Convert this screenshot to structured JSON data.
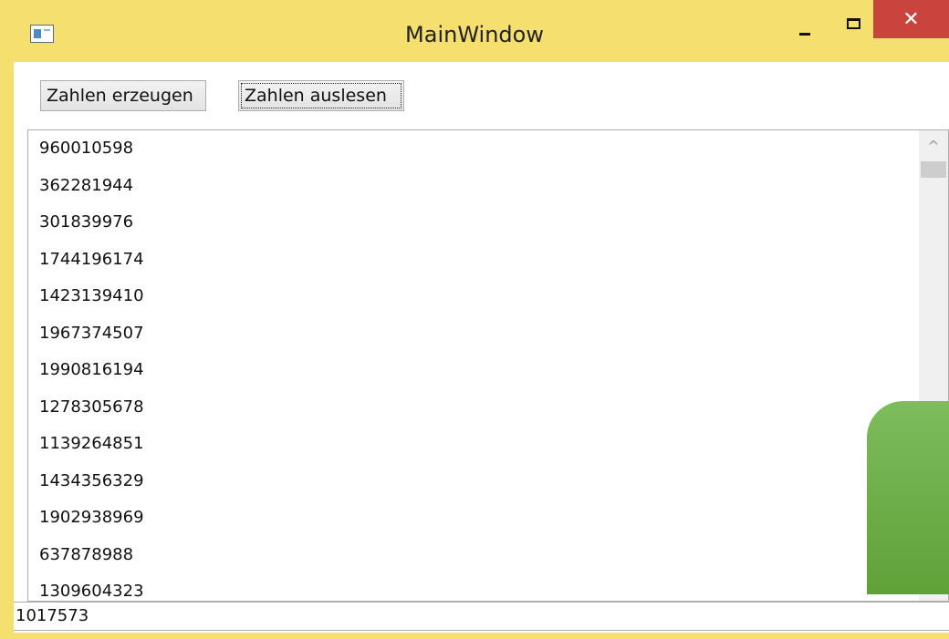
{
  "window": {
    "title": "MainWindow",
    "minimize_icon": "minimize-icon",
    "maximize_icon": "maximize-icon",
    "close_icon": "close-icon",
    "close_glyph": "✕",
    "accent_color": "#f5df6e",
    "close_color": "#c9443c"
  },
  "toolbar": {
    "generate_label": "Zahlen erzeugen",
    "read_label": "Zahlen auslesen"
  },
  "list": {
    "items": [
      "960010598",
      "362281944",
      "301839976",
      "1744196174",
      "1423139410",
      "1967374507",
      "1990816194",
      "1278305678",
      "1139264851",
      "1434356329",
      "1902938969",
      "637878988",
      "1309604323"
    ],
    "scroll_up_glyph": "^"
  },
  "status": {
    "value": "1017573"
  }
}
